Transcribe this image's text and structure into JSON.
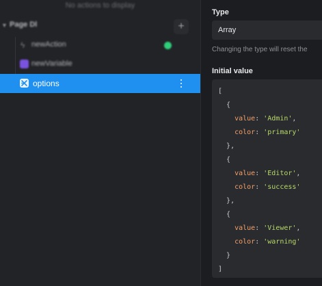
{
  "left": {
    "empty_message": "No actions to display",
    "group": {
      "label": "Page Dl",
      "add_label": "+"
    },
    "items": [
      {
        "label": "newAction",
        "status_color": "#2fd07a"
      },
      {
        "label": "newVariable",
        "icon_color": "#7a52e0"
      },
      {
        "label": "options",
        "selected": true,
        "selected_color": "#1f8ff0"
      }
    ]
  },
  "right": {
    "type": {
      "label": "Type",
      "value": "Array",
      "hint": "Changing the type will reset the"
    },
    "initial_value": {
      "label": "Initial value",
      "open": "[",
      "close": "]",
      "entries": [
        {
          "value": "'Admin'",
          "color": "'primary'"
        },
        {
          "value": "'Editor'",
          "color": "'success'"
        },
        {
          "value": "'Viewer'",
          "color": "'warning'"
        }
      ],
      "key_value": "value",
      "key_color": "color"
    }
  }
}
